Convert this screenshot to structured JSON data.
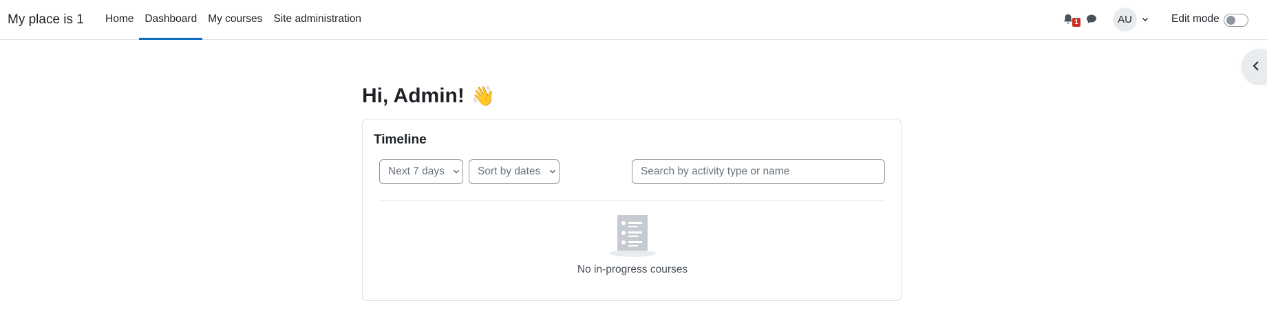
{
  "site": {
    "name": "My place is 1"
  },
  "nav": {
    "items": [
      {
        "label": "Home",
        "active": false
      },
      {
        "label": "Dashboard",
        "active": true
      },
      {
        "label": "My courses",
        "active": false
      },
      {
        "label": "Site administration",
        "active": false
      }
    ]
  },
  "header_right": {
    "notification_count": "1",
    "avatar_initials": "AU",
    "edit_mode_label": "Edit mode",
    "edit_mode_on": false
  },
  "main": {
    "greeting": "Hi, Admin!",
    "greeting_emoji": "👋",
    "timeline": {
      "title": "Timeline",
      "days_filter": "Next 7 days",
      "sort_filter": "Sort by dates",
      "search_placeholder": "Search by activity type or name",
      "search_value": "",
      "empty_text": "No in-progress courses"
    }
  },
  "colors": {
    "accent": "#0f6cbf",
    "badge": "#ca3120"
  }
}
